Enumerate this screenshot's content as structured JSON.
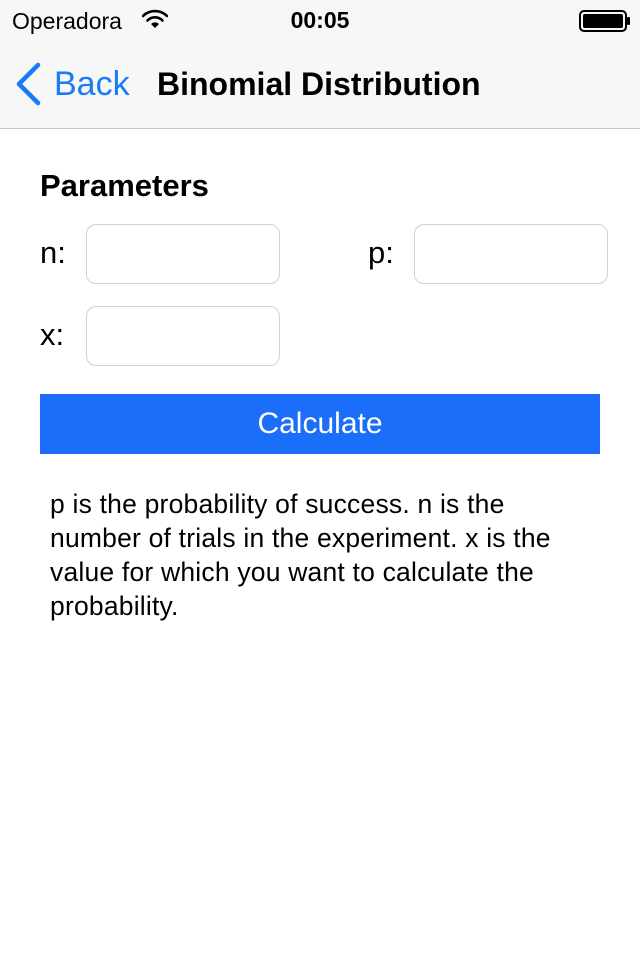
{
  "status_bar": {
    "carrier": "Operadora",
    "time": "00:05",
    "wifi_icon": "wifi-icon",
    "battery_icon": "battery-icon"
  },
  "nav_bar": {
    "back_label": "Back",
    "title": "Binomial Distribution",
    "back_icon": "chevron-left-icon",
    "accent_color": "#1a7cf5"
  },
  "form": {
    "section_title": "Parameters",
    "fields": {
      "n": {
        "label": "n:",
        "value": "",
        "placeholder": ""
      },
      "p": {
        "label": "p:",
        "value": "",
        "placeholder": ""
      },
      "x": {
        "label": "x:",
        "value": "",
        "placeholder": ""
      }
    },
    "calculate_label": "Calculate",
    "button_color": "#1a6ef9"
  },
  "description": "p is the probability of success. n is the number of trials in the experiment. x is the value for which you want to calculate the probability."
}
